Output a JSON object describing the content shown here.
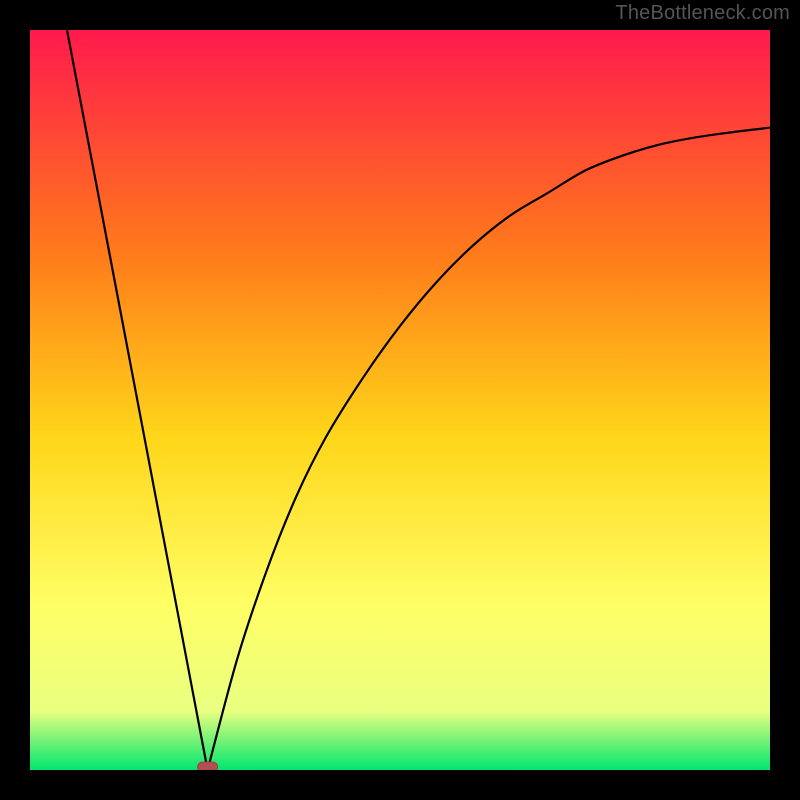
{
  "watermark": "TheBottleneck.com",
  "chart_data": {
    "type": "line",
    "title": "",
    "xlabel": "",
    "ylabel": "",
    "xlim": [
      0,
      100
    ],
    "ylim": [
      0,
      100
    ],
    "gradient_colors": {
      "top": "#ff1a4d",
      "upper_mid": "#ff7a1a",
      "mid": "#ffd61a",
      "lower_mid": "#ffff66",
      "near_bottom": "#eaff80",
      "bottom": "#00e66e"
    },
    "series": [
      {
        "name": "left-branch",
        "x": [
          5,
          24
        ],
        "y": [
          100,
          0
        ]
      },
      {
        "name": "right-branch",
        "x": [
          24,
          28,
          32,
          36,
          40,
          45,
          50,
          55,
          60,
          65,
          70,
          75,
          80,
          85,
          90,
          95,
          100
        ],
        "y": [
          0,
          15,
          27,
          37,
          45,
          53,
          60,
          66,
          71,
          75,
          78,
          81,
          83,
          84.5,
          85.5,
          86.2,
          86.8
        ]
      }
    ],
    "marker": {
      "name": "minimum-marker",
      "x": 24,
      "y": 0,
      "shape": "pill",
      "color": "#b05050"
    }
  }
}
